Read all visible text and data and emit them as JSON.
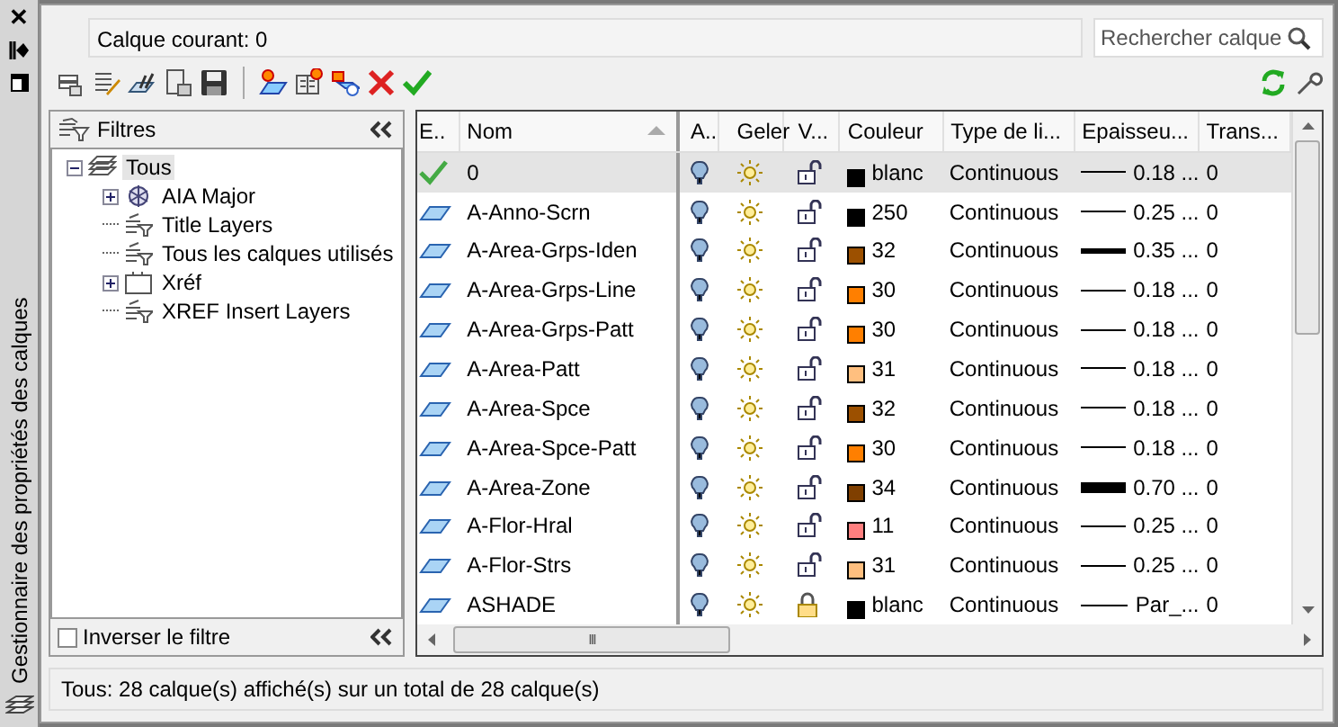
{
  "side_strip": {
    "close": "✕",
    "title": "Gestionnaire des propriétés des calques"
  },
  "current_layer": "Calque courant: 0",
  "search": {
    "placeholder": "Rechercher calque"
  },
  "filters": {
    "title": "Filtres",
    "tree": [
      {
        "label": "Tous",
        "kind": "all",
        "expanded": true,
        "selected": true,
        "children": [
          {
            "label": "AIA Major",
            "kind": "group",
            "expanded": false,
            "selected": false
          },
          {
            "label": "Title Layers",
            "kind": "filter",
            "selected": false
          },
          {
            "label": "Tous les calques utilisés",
            "kind": "filter",
            "selected": false
          },
          {
            "label": "Xréf",
            "kind": "xref",
            "expanded": false,
            "selected": false
          },
          {
            "label": "XREF Insert Layers",
            "kind": "filter",
            "selected": false
          }
        ]
      }
    ],
    "invert": {
      "label": "Inverser le filtre",
      "checked": false
    }
  },
  "table": {
    "columns": [
      "E..",
      "Nom",
      "A..",
      "Geler",
      "V...",
      "Couleur",
      "Type de li...",
      "Epaisseu...",
      "Trans..."
    ],
    "rows": [
      {
        "kind": "current",
        "name": "0",
        "locked": false,
        "color": "#000000",
        "color_label": "blanc",
        "linetype": "Continuous",
        "lineweight": {
          "kind": "thin",
          "text": "0.18 ..."
        },
        "transparency": "0",
        "selected": true
      },
      {
        "kind": "layer",
        "name": "A-Anno-Scrn",
        "locked": false,
        "color": "#000000",
        "color_label": "250",
        "linetype": "Continuous",
        "lineweight": {
          "kind": "thin",
          "text": "0.25 ..."
        },
        "transparency": "0",
        "selected": false
      },
      {
        "kind": "layer",
        "name": "A-Area-Grps-Iden",
        "locked": false,
        "color": "#9c5000",
        "color_label": "32",
        "linetype": "Continuous",
        "lineweight": {
          "kind": "medium",
          "text": "0.35 ..."
        },
        "transparency": "0",
        "selected": false
      },
      {
        "kind": "layer",
        "name": "A-Area-Grps-Line",
        "locked": false,
        "color": "#ff7f00",
        "color_label": "30",
        "linetype": "Continuous",
        "lineweight": {
          "kind": "thin",
          "text": "0.18 ..."
        },
        "transparency": "0",
        "selected": false
      },
      {
        "kind": "layer",
        "name": "A-Area-Grps-Patt",
        "locked": false,
        "color": "#ff7f00",
        "color_label": "30",
        "linetype": "Continuous",
        "lineweight": {
          "kind": "thin",
          "text": "0.18 ..."
        },
        "transparency": "0",
        "selected": false
      },
      {
        "kind": "layer",
        "name": "A-Area-Patt",
        "locked": false,
        "color": "#ffbf7f",
        "color_label": "31",
        "linetype": "Continuous",
        "lineweight": {
          "kind": "thin",
          "text": "0.18 ..."
        },
        "transparency": "0",
        "selected": false
      },
      {
        "kind": "layer",
        "name": "A-Area-Spce",
        "locked": false,
        "color": "#9c5000",
        "color_label": "32",
        "linetype": "Continuous",
        "lineweight": {
          "kind": "thin",
          "text": "0.18 ..."
        },
        "transparency": "0",
        "selected": false
      },
      {
        "kind": "layer",
        "name": "A-Area-Spce-Patt",
        "locked": false,
        "color": "#ff7f00",
        "color_label": "30",
        "linetype": "Continuous",
        "lineweight": {
          "kind": "thin",
          "text": "0.18 ..."
        },
        "transparency": "0",
        "selected": false
      },
      {
        "kind": "layer",
        "name": "A-Area-Zone",
        "locked": false,
        "color": "#7f3f00",
        "color_label": "34",
        "linetype": "Continuous",
        "lineweight": {
          "kind": "heavy",
          "text": "0.70 ..."
        },
        "transparency": "0",
        "selected": false
      },
      {
        "kind": "layer",
        "name": "A-Flor-Hral",
        "locked": false,
        "color": "#ff7f7f",
        "color_label": "11",
        "linetype": "Continuous",
        "lineweight": {
          "kind": "thin",
          "text": "0.25 ..."
        },
        "transparency": "0",
        "selected": false
      },
      {
        "kind": "layer",
        "name": "A-Flor-Strs",
        "locked": false,
        "color": "#ffbf7f",
        "color_label": "31",
        "linetype": "Continuous",
        "lineweight": {
          "kind": "thin",
          "text": "0.25 ..."
        },
        "transparency": "0",
        "selected": false
      },
      {
        "kind": "layer",
        "name": "ASHADE",
        "locked": true,
        "color": "#000000",
        "color_label": "blanc",
        "linetype": "Continuous",
        "lineweight": {
          "kind": "thin",
          "text": "Par_..."
        },
        "transparency": "0",
        "selected": false
      }
    ]
  },
  "scroll_grip": "III",
  "status_bar": "Tous: 28 calque(s) affiché(s) sur un total de 28 calque(s)"
}
